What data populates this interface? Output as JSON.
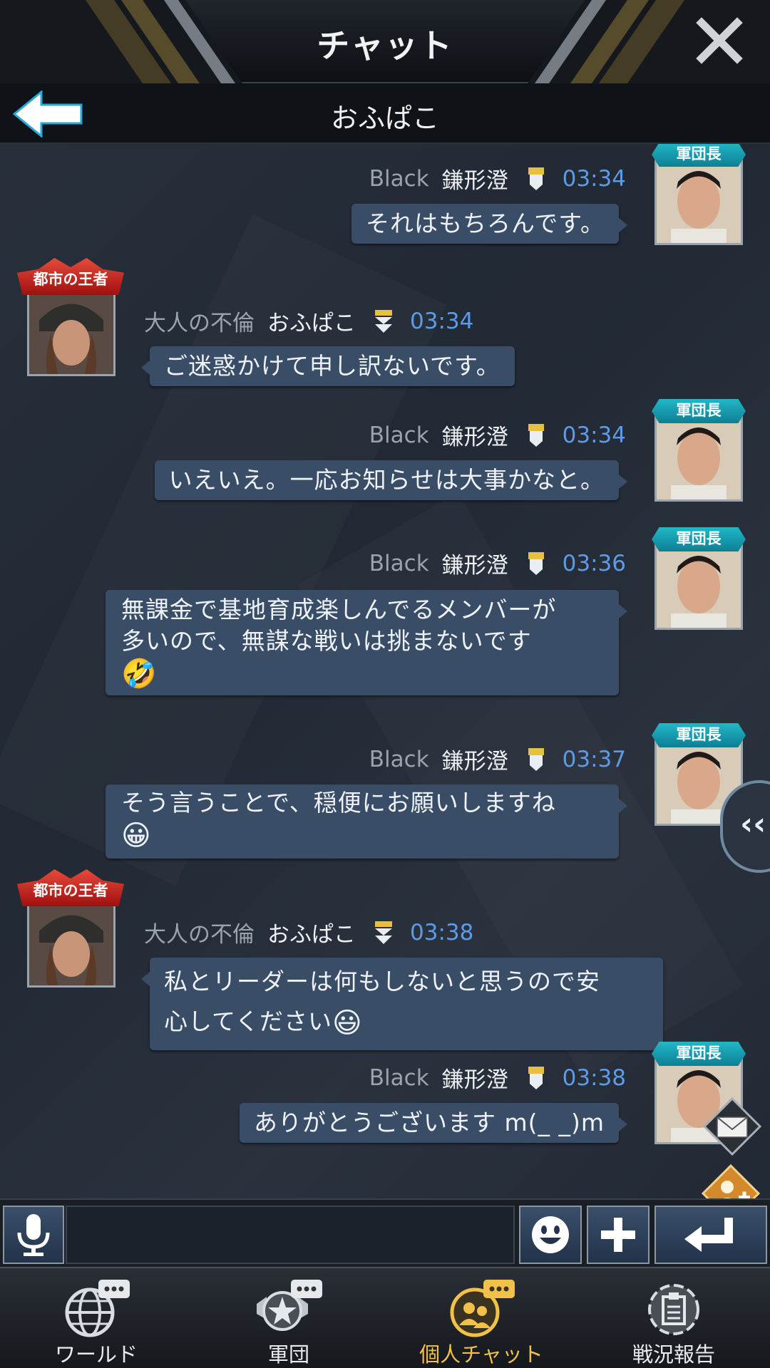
{
  "header": {
    "title": "チャット",
    "conversation_title": "おふぱこ"
  },
  "messages": [
    {
      "side": "right",
      "alliance": "Black",
      "name": "鎌形澄",
      "time": "03:34",
      "badge": "軍団長",
      "text_lines": [
        "それはもちろんです。"
      ],
      "emoji": ""
    },
    {
      "side": "left",
      "alliance": "大人の不倫",
      "name": "おふぱこ",
      "time": "03:34",
      "badge": "都市の王者",
      "text_lines": [
        "ご迷惑かけて申し訳ないです。"
      ],
      "emoji": ""
    },
    {
      "side": "right",
      "alliance": "Black",
      "name": "鎌形澄",
      "time": "03:34",
      "badge": "軍団長",
      "text_lines": [
        "いえいえ。一応お知らせは大事かなと。"
      ],
      "emoji": ""
    },
    {
      "side": "right",
      "alliance": "Black",
      "name": "鎌形澄",
      "time": "03:36",
      "badge": "軍団長",
      "text_lines": [
        "無課金で基地育成楽しんでるメンバーが",
        "多いので、無謀な戦いは挑まないです"
      ],
      "emoji": "🤣"
    },
    {
      "side": "right",
      "alliance": "Black",
      "name": "鎌形澄",
      "time": "03:37",
      "badge": "軍団長",
      "text_lines": [
        "そう言うことで、穏便にお願いしますね"
      ],
      "emoji": "😀"
    },
    {
      "side": "left",
      "alliance": "大人の不倫",
      "name": "おふぱこ",
      "time": "03:38",
      "badge": "都市の王者",
      "text_lines": [
        "私とリーダーは何もしないと思うので安",
        "心してください"
      ],
      "emoji": "😃"
    },
    {
      "side": "right",
      "alliance": "Black",
      "name": "鎌形澄",
      "time": "03:38",
      "badge": "軍団長",
      "text_lines": [
        "ありがとうございます m(_ _)m"
      ],
      "emoji": ""
    }
  ],
  "side_tab": {
    "label": "‹‹"
  },
  "input": {
    "value": "",
    "placeholder": ""
  },
  "nav": {
    "items": [
      {
        "label": "ワールド",
        "icon": "globe-chat-icon"
      },
      {
        "label": "軍団",
        "icon": "legion-chat-icon"
      },
      {
        "label": "個人チャット",
        "icon": "private-chat-icon",
        "active": true
      },
      {
        "label": "戦況報告",
        "icon": "report-icon"
      }
    ]
  },
  "colors": {
    "bubble": "#3a4d66",
    "time": "#5b9be8",
    "active_nav": "#f2c14a",
    "background": "#232b37"
  }
}
